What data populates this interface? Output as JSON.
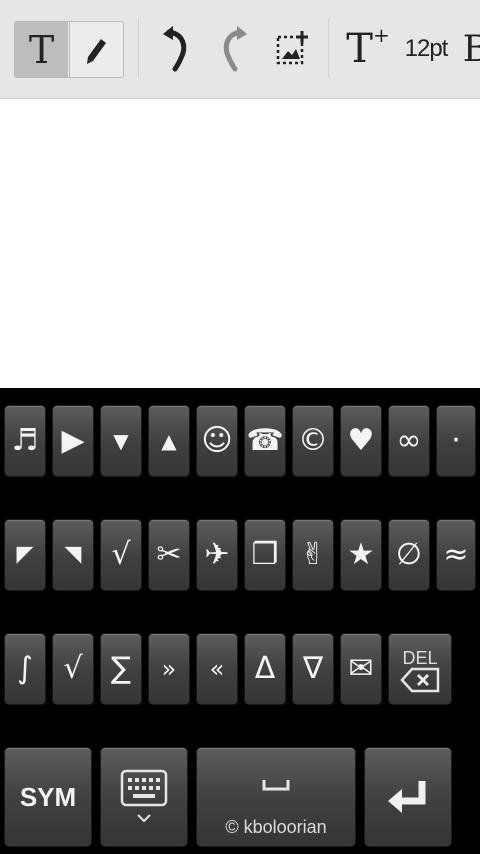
{
  "toolbar": {
    "text_tool_label": "T",
    "font_size_label": "12pt",
    "text_grow_label": "T",
    "text_grow_sup": "+",
    "icons": [
      "text-tool-icon",
      "pen-icon",
      "undo-icon",
      "redo-icon",
      "select-image-icon",
      "text-size-increase-icon"
    ]
  },
  "keyboard": {
    "row1": [
      "♬",
      "▶",
      "▼",
      "▲",
      "☺",
      "☎",
      "©",
      "♥",
      "∞",
      "·"
    ],
    "row2": [
      "◤",
      "◥",
      "√",
      "✂",
      "✈",
      "❐",
      "✌",
      "★",
      "∅",
      "≈"
    ],
    "row3": [
      "∫",
      "√",
      "∑",
      "»",
      "«",
      "Δ",
      "∇",
      "✉"
    ],
    "del_label": "DEL",
    "sym_label": "SYM",
    "space_label": "© kboloorian",
    "keyboard_switch_icon": "keyboard-icon",
    "enter_icon": "enter-arrow-icon"
  }
}
